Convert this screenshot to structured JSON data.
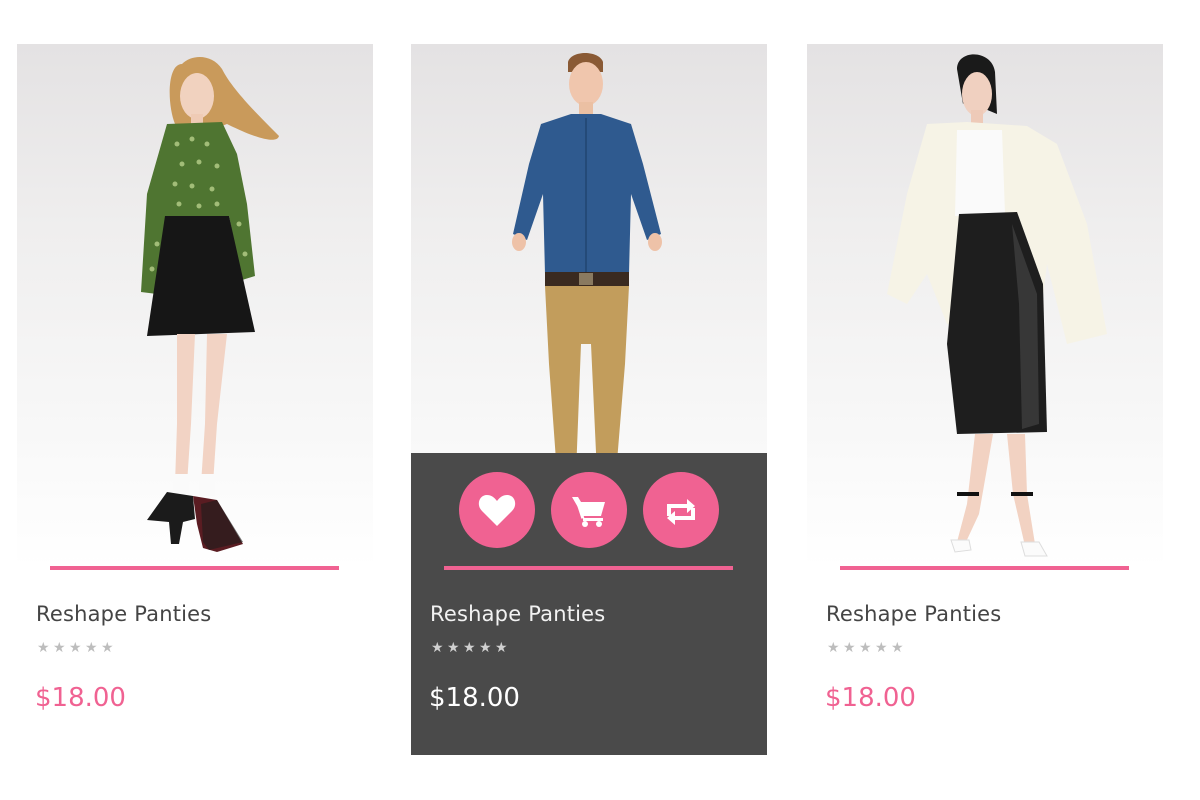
{
  "theme": {
    "accent": "#f06292",
    "hover_panel": "#4a4a4a",
    "star_color": "#bdbdbd"
  },
  "products": [
    {
      "title": "Reshape Panties",
      "price": "$18.00",
      "rating": 0,
      "state": "default",
      "image": "woman in green polka-dot blouse and black skirt"
    },
    {
      "title": "Reshape Panties",
      "price": "$18.00",
      "rating": 0,
      "state": "hover",
      "image": "man in denim shirt and khaki trousers",
      "actions": [
        {
          "name": "wishlist",
          "icon": "heart-icon"
        },
        {
          "name": "add-to-cart",
          "icon": "cart-icon"
        },
        {
          "name": "compare",
          "icon": "compare-arrows-icon"
        }
      ]
    },
    {
      "title": "Reshape Panties",
      "price": "$18.00",
      "rating": 0,
      "state": "default",
      "image": "woman in white coat and black leather skirt"
    }
  ]
}
